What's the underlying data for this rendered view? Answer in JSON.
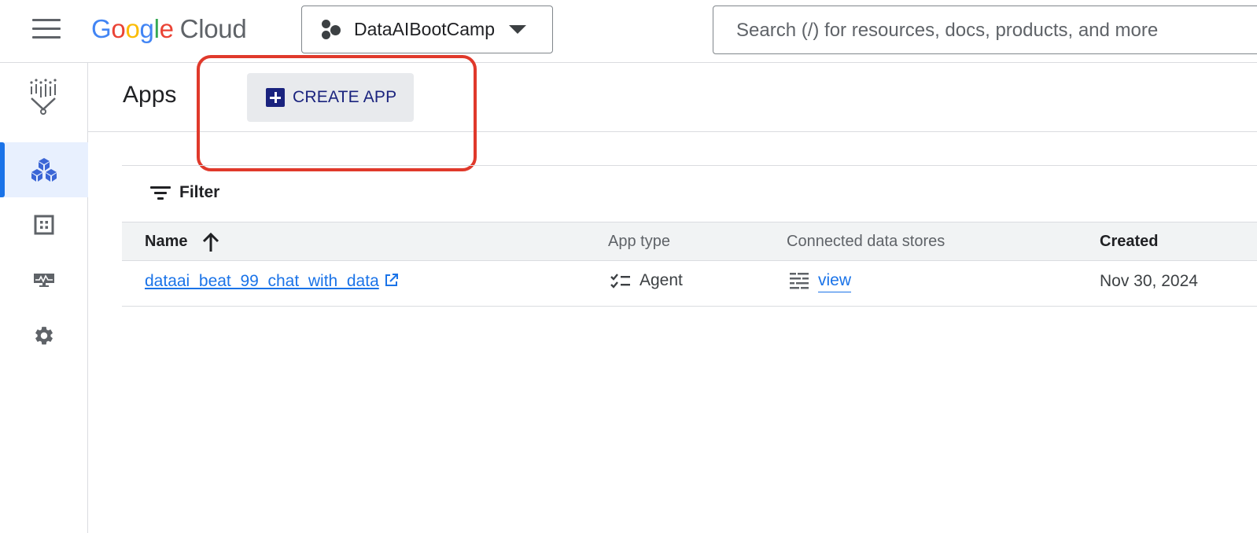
{
  "header": {
    "logo_letters": [
      {
        "ch": "G",
        "color": "#4285F4"
      },
      {
        "ch": "o",
        "color": "#EA4335"
      },
      {
        "ch": "o",
        "color": "#FBBC05"
      },
      {
        "ch": "g",
        "color": "#4285F4"
      },
      {
        "ch": "l",
        "color": "#34A853"
      },
      {
        "ch": "e",
        "color": "#EA4335"
      }
    ],
    "logo_product": "Cloud",
    "project_name": "DataAIBootCamp",
    "search_placeholder": "Search (/) for resources, docs, products, and more"
  },
  "rail": {
    "items": [
      {
        "icon": "agent-builder-logo-icon",
        "active": false
      },
      {
        "icon": "apps-cubes-icon",
        "active": true
      },
      {
        "icon": "data-grid-icon",
        "active": false
      },
      {
        "icon": "monitoring-icon",
        "active": false
      },
      {
        "icon": "settings-gear-icon",
        "active": false
      }
    ],
    "accent": "#1a73e8"
  },
  "page": {
    "title": "Apps",
    "create_button_label": "CREATE APP",
    "highlight_color": "#e0392b"
  },
  "table": {
    "filter_label": "Filter",
    "columns": [
      "Name",
      "App type",
      "Connected data stores",
      "Created"
    ],
    "sort": {
      "column": "Name",
      "direction": "ascending"
    },
    "rows": [
      {
        "name": "dataai_beat_99_chat_with_data",
        "app_type": "Agent",
        "data_stores_link": "view",
        "created": "Nov 30, 2024"
      }
    ]
  }
}
